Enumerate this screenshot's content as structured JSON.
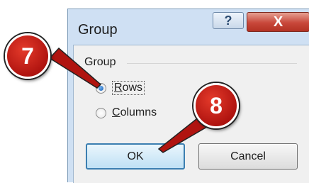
{
  "dialog": {
    "title": "Group",
    "help_glyph": "?",
    "close_glyph": "X",
    "group_label": "Group",
    "options": [
      {
        "label_prefix": "",
        "label_underlined": "R",
        "label_rest": "ows",
        "selected": true
      },
      {
        "label_prefix": "",
        "label_underlined": "C",
        "label_rest": "olumns",
        "selected": false
      }
    ],
    "ok_label": "OK",
    "cancel_label": "Cancel"
  },
  "callouts": [
    {
      "number": "7"
    },
    {
      "number": "8"
    }
  ],
  "colors": {
    "callout_red": "#b01410",
    "dialog_frame": "#cfe0f3",
    "close_red": "#c8473a"
  }
}
